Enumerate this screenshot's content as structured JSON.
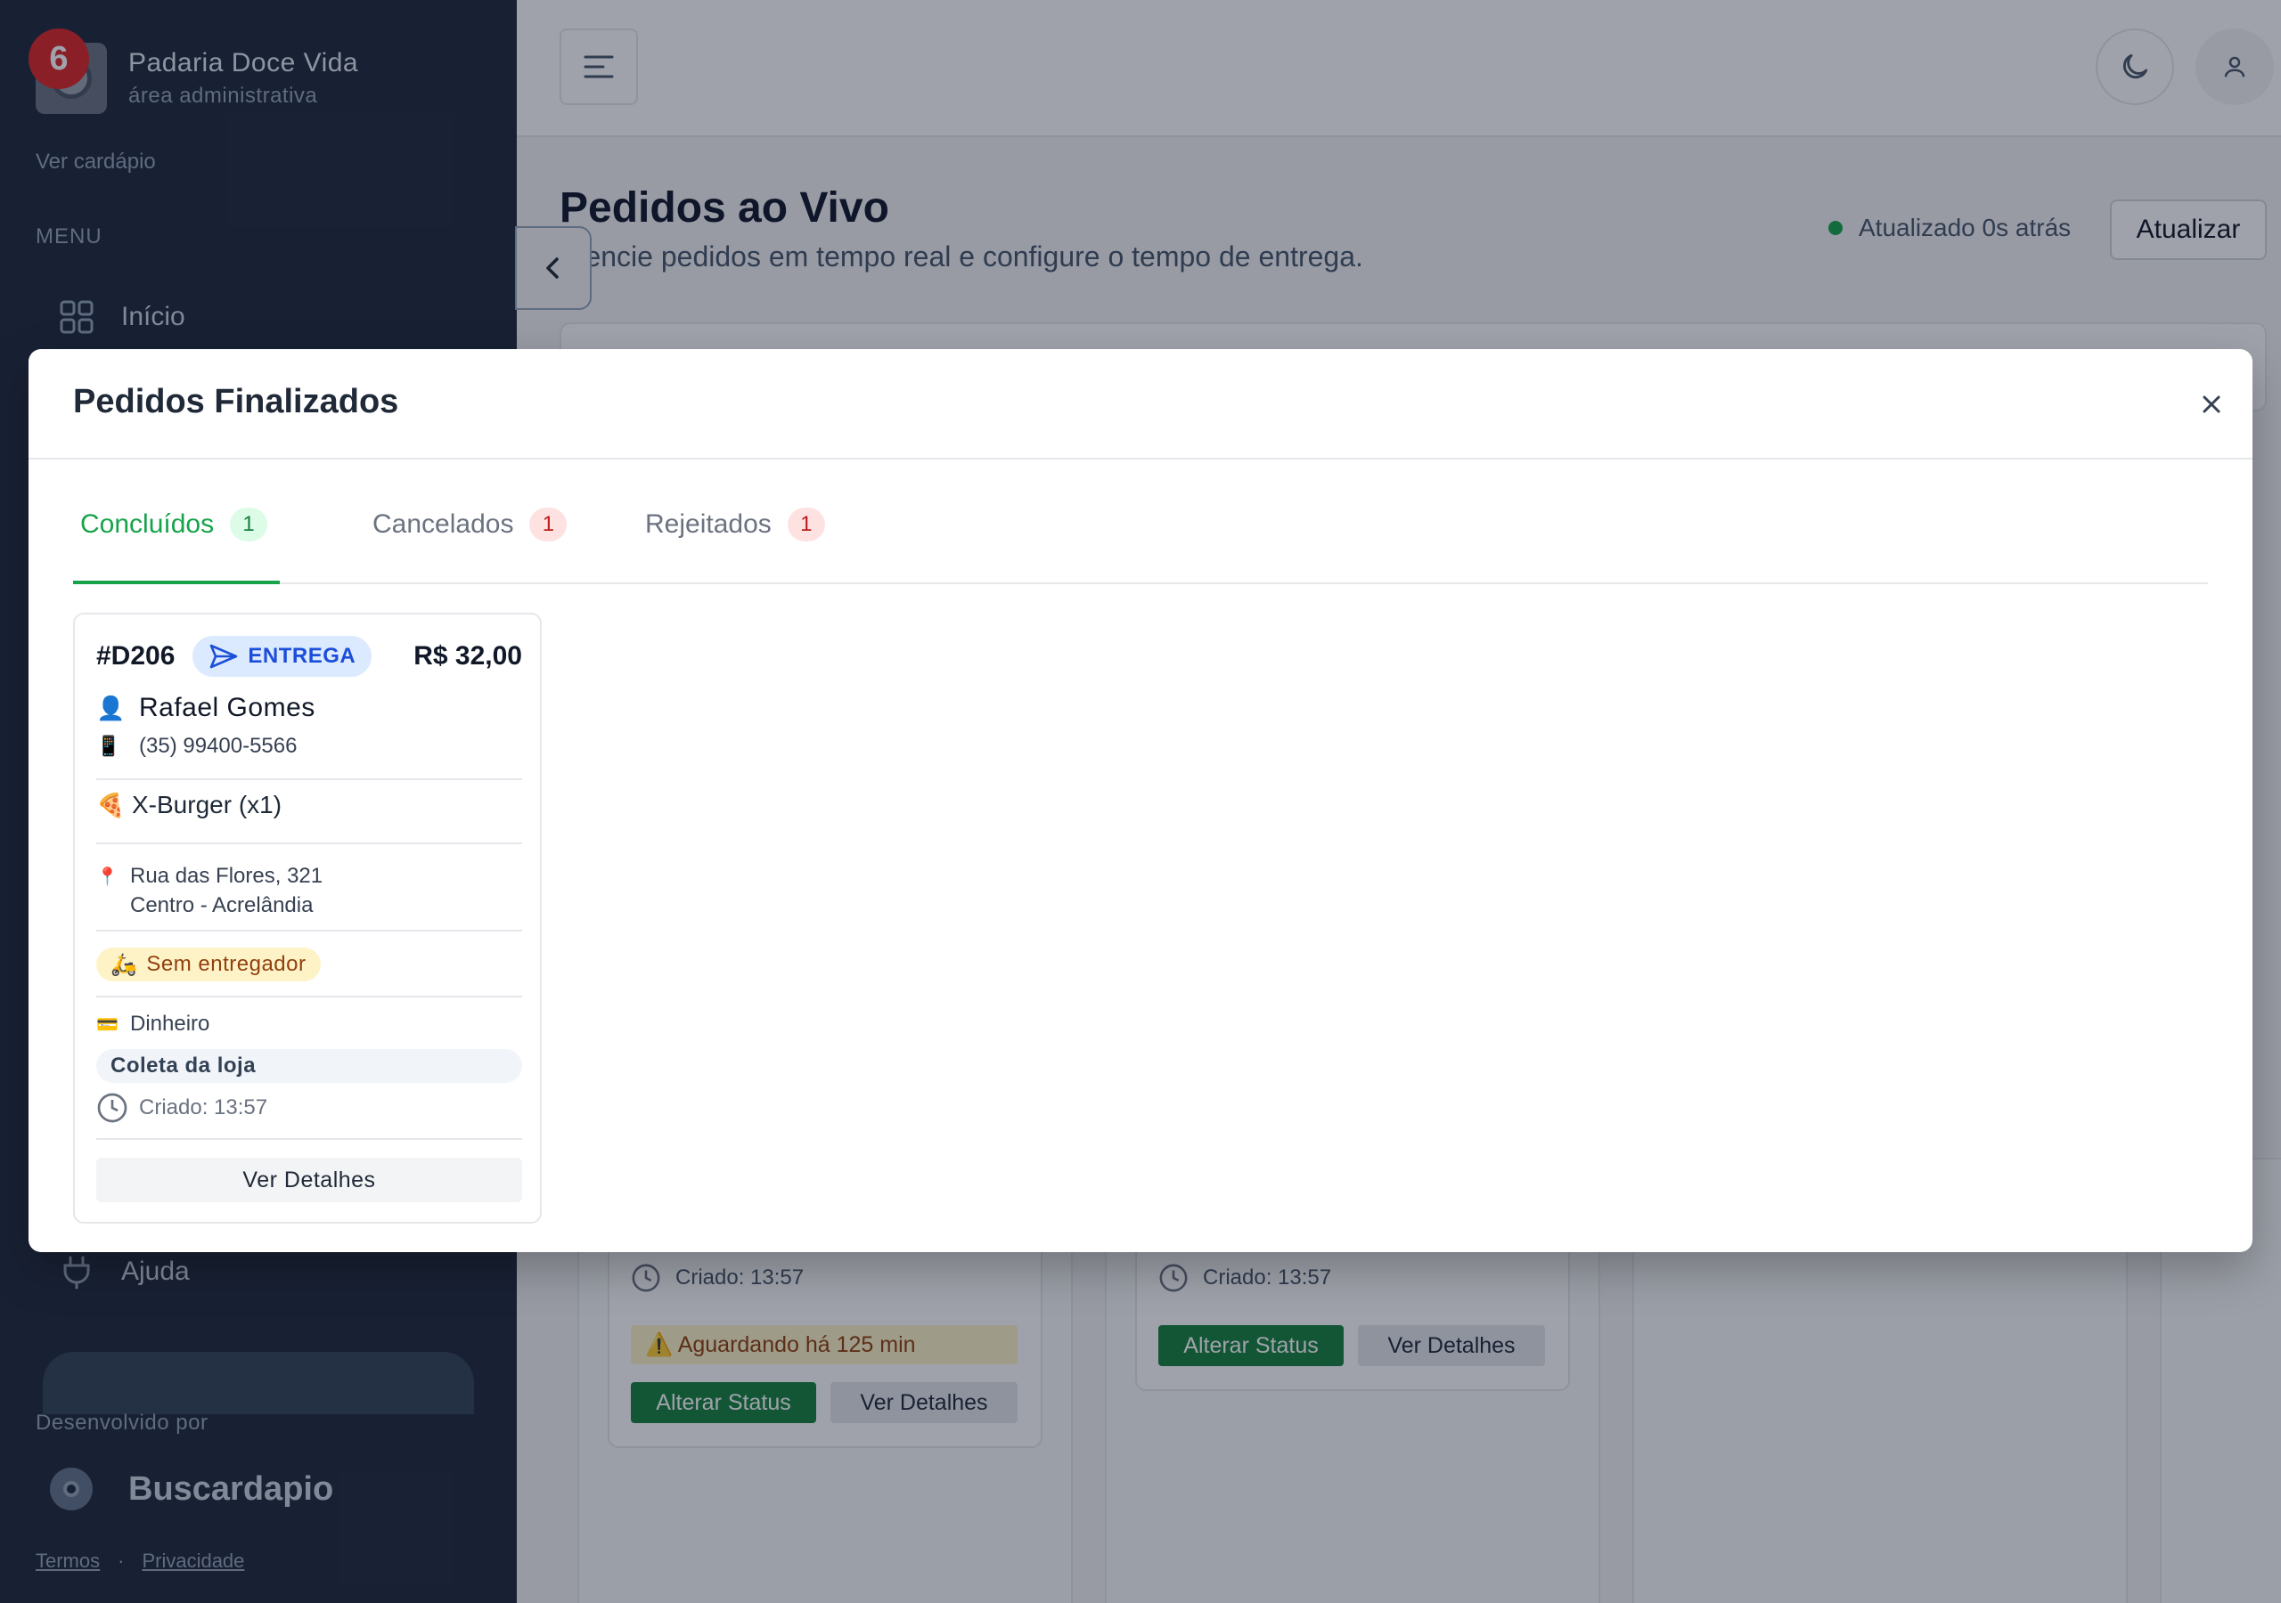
{
  "sidebar": {
    "notification_count": "6",
    "brand_name": "Padaria Doce Vida",
    "brand_sub": "área administrativa",
    "view_menu_link": "Ver cardápio",
    "menu_title": "MENU",
    "nav": [
      {
        "label": "Início",
        "icon": "grid-icon"
      },
      {
        "label": "Ajuda",
        "icon": "help-plug-icon"
      }
    ],
    "developed_by": "Desenvolvido por",
    "developer_name": "Buscardapio",
    "terms": "Termos",
    "separator": "·",
    "privacy": "Privacidade"
  },
  "header": {
    "menu_toggle_icon": "menu-icon",
    "theme_icon": "moon-icon",
    "user_icon": "user-icon"
  },
  "page": {
    "title": "Pedidos ao Vivo",
    "subtitle": "erencie pedidos em tempo real e configure o tempo de entrega.",
    "updated_text": "Atualizado 0s atrás",
    "refresh_label": "Atualizar"
  },
  "board": {
    "cards": [
      {
        "created": "Criado: 13:57",
        "warning": "⚠️ Aguardando há 125 min",
        "status_btn": "Alterar Status",
        "details_btn": "Ver Detalhes"
      },
      {
        "created": "Criado: 13:57",
        "status_btn": "Alterar Status",
        "details_btn": "Ver Detalhes"
      }
    ]
  },
  "modal": {
    "title": "Pedidos Finalizados",
    "close_icon": "close-icon",
    "tabs": [
      {
        "label": "Concluídos",
        "count": "1",
        "active": true
      },
      {
        "label": "Cancelados",
        "count": "1",
        "active": false
      },
      {
        "label": "Rejeitados",
        "count": "1",
        "active": false
      }
    ],
    "order": {
      "id": "#D206",
      "type": "ENTREGA",
      "total": "R$ 32,00",
      "customer": "Rafael Gomes",
      "phone": "(35) 99400-5566",
      "item": "X-Burger (x1)",
      "address_line1": "Rua das Flores, 321",
      "address_line2": "Centro - Acrelândia",
      "driver_status": "Sem entregador",
      "payment": "Dinheiro",
      "pickup": "Coleta da loja",
      "created": "Criado: 13:57",
      "details_btn": "Ver Detalhes"
    }
  },
  "colors": {
    "sidebar_bg": "#1e293b",
    "accent_green": "#16a34a",
    "badge_red": "#dc2626",
    "delivery_blue": "#1d4ed8"
  }
}
